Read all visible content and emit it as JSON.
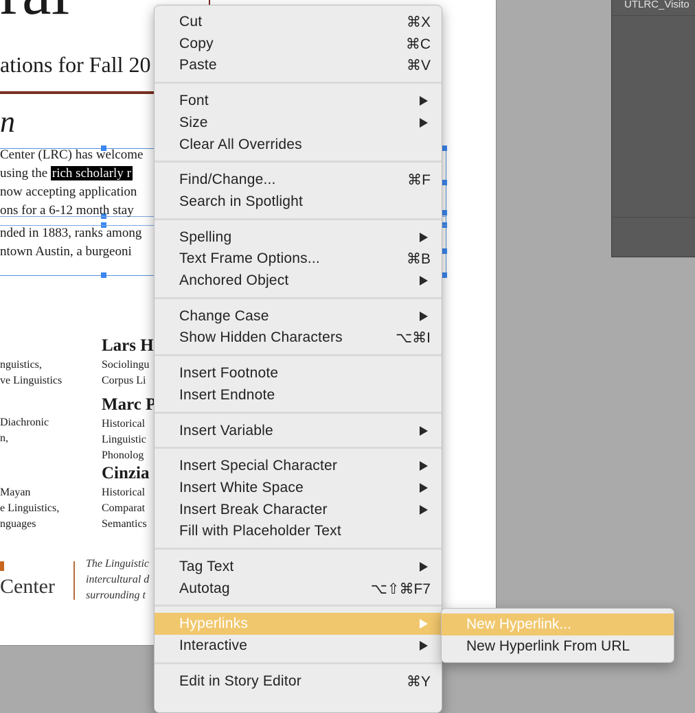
{
  "document": {
    "title_fragment": "rai",
    "subtitle_fragment": "ations for Fall 20",
    "italic_heading_fragment": "n",
    "body_lines": [
      {
        "before": "Center (LRC) has welcome",
        "highlight": "",
        "after": ""
      },
      {
        "before": "using the ",
        "highlight": "rich scholarly r",
        "after": ""
      },
      {
        "before": "now accepting application",
        "highlight": "",
        "after": ""
      },
      {
        "before": "ons for a 6-12 month stay",
        "highlight": "",
        "after": ""
      },
      {
        "before": "nded in 1883, ranks among",
        "highlight": "",
        "after": ""
      },
      {
        "before": "ntown Austin, a burgeoni",
        "highlight": "",
        "after": ""
      }
    ],
    "left_column": [
      "nguistics,",
      "ve Linguistics",
      "Diachronic",
      "n,",
      "Mayan",
      "e Linguistics,",
      "nguages"
    ],
    "people": [
      {
        "name": "Lars H",
        "fields": [
          "Sociolingu",
          "Corpus Li"
        ]
      },
      {
        "name": "Marc P",
        "fields": [
          "Historical",
          "Linguistic",
          "Phonolog"
        ]
      },
      {
        "name": "Cinzia",
        "fields": [
          "Historical",
          "Comparat",
          "Semantics"
        ]
      }
    ],
    "logo_text": "Center",
    "footer_italic": [
      "The Linguistic",
      "intercultural d",
      "surrounding t"
    ]
  },
  "side_panel": {
    "label": "UTLRC_Visito"
  },
  "context_menu": {
    "groups": [
      [
        {
          "label": "Cut",
          "shortcut": "⌘X"
        },
        {
          "label": "Copy",
          "shortcut": "⌘C"
        },
        {
          "label": "Paste",
          "shortcut": "⌘V"
        }
      ],
      [
        {
          "label": "Font",
          "submenu": true
        },
        {
          "label": "Size",
          "submenu": true
        },
        {
          "label": "Clear All Overrides"
        }
      ],
      [
        {
          "label": "Find/Change...",
          "shortcut": "⌘F"
        },
        {
          "label": "Search in Spotlight"
        }
      ],
      [
        {
          "label": "Spelling",
          "submenu": true
        },
        {
          "label": "Text Frame Options...",
          "shortcut": "⌘B"
        },
        {
          "label": "Anchored Object",
          "submenu": true
        }
      ],
      [
        {
          "label": "Change Case",
          "submenu": true
        },
        {
          "label": "Show Hidden Characters",
          "shortcut": "⌥⌘I"
        }
      ],
      [
        {
          "label": "Insert Footnote"
        },
        {
          "label": "Insert Endnote"
        }
      ],
      [
        {
          "label": "Insert Variable",
          "submenu": true
        }
      ],
      [
        {
          "label": "Insert Special Character",
          "submenu": true
        },
        {
          "label": "Insert White Space",
          "submenu": true
        },
        {
          "label": "Insert Break Character",
          "submenu": true
        },
        {
          "label": "Fill with Placeholder Text"
        }
      ],
      [
        {
          "label": "Tag Text",
          "submenu": true
        },
        {
          "label": "Autotag",
          "shortcut": "⌥⇧⌘F7"
        }
      ],
      [
        {
          "label": "Hyperlinks",
          "submenu": true,
          "active": true
        },
        {
          "label": "Interactive",
          "submenu": true
        }
      ],
      [
        {
          "label": "Edit in Story Editor",
          "shortcut": "⌘Y"
        }
      ]
    ],
    "highlight_color": "#f1c76d"
  },
  "hyperlinks_submenu": [
    {
      "label": "New Hyperlink...",
      "active": true
    },
    {
      "label": "New Hyperlink From URL"
    }
  ]
}
